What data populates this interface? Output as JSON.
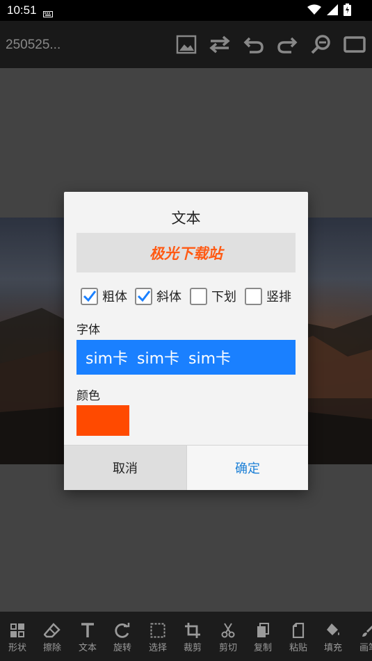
{
  "status_bar": {
    "time": "10:51"
  },
  "toolbar": {
    "title": "250525..."
  },
  "dialog": {
    "title": "文本",
    "preview_text": "极光下载站",
    "options": [
      {
        "label": "粗体",
        "checked": true
      },
      {
        "label": "斜体",
        "checked": true
      },
      {
        "label": "下划",
        "checked": false
      },
      {
        "label": "竖排",
        "checked": false
      }
    ],
    "font_label": "字体",
    "font_value": "sim卡 sim卡 sim卡",
    "color_label": "颜色",
    "color_value": "#ff4a00",
    "cancel_label": "取消",
    "confirm_label": "确定"
  },
  "bottom_tools": [
    {
      "label": "形状",
      "icon": "grid-icon"
    },
    {
      "label": "擦除",
      "icon": "eraser-icon"
    },
    {
      "label": "文本",
      "icon": "text-icon"
    },
    {
      "label": "旋转",
      "icon": "rotate-icon"
    },
    {
      "label": "选择",
      "icon": "select-icon"
    },
    {
      "label": "裁剪",
      "icon": "crop-icon"
    },
    {
      "label": "剪切",
      "icon": "scissors-icon"
    },
    {
      "label": "复制",
      "icon": "copy-icon"
    },
    {
      "label": "粘贴",
      "icon": "paste-icon"
    },
    {
      "label": "填充",
      "icon": "fill-icon"
    },
    {
      "label": "画笔",
      "icon": "brush-icon"
    }
  ],
  "colors": {
    "accent": "#1a80ff",
    "confirm_text": "#1b7fd6",
    "preview_text": "#ff5a14"
  }
}
